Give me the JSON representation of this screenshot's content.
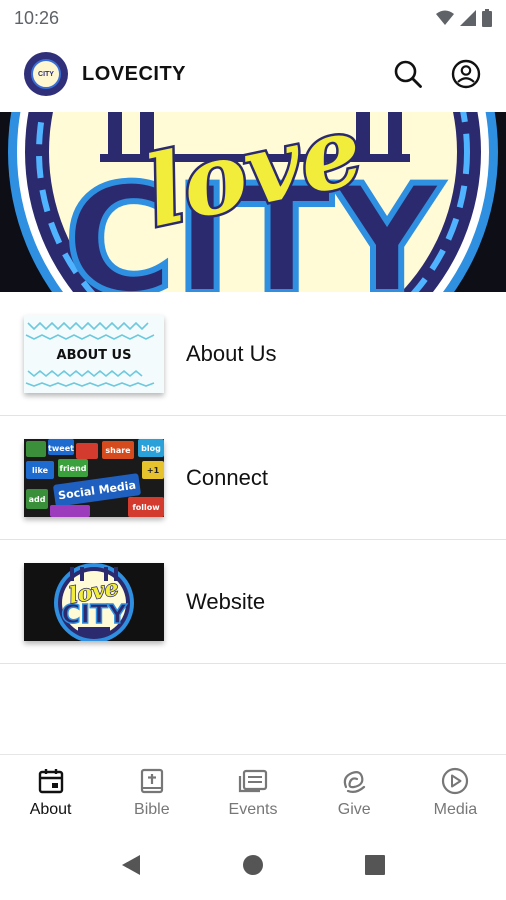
{
  "status_bar": {
    "time": "10:26"
  },
  "app_bar": {
    "title": "LOVECITY",
    "logo_text": "CITY"
  },
  "banner": {
    "script_text": "love",
    "block_text": "CITY"
  },
  "list": {
    "items": [
      {
        "label": "About Us",
        "thumb_text": "ABOUT US"
      },
      {
        "label": "Connect",
        "thumb_text": "Social Media",
        "thumb_tags": [
          "tweet",
          "friend",
          "share",
          "blog",
          "like",
          "add",
          "follow",
          "+1"
        ]
      },
      {
        "label": "Website",
        "thumb_text": "love",
        "thumb_text2": "CITY"
      }
    ]
  },
  "bottom_nav": {
    "items": [
      {
        "label": "About",
        "icon": "calendar-icon",
        "active": true
      },
      {
        "label": "Bible",
        "icon": "bible-icon",
        "active": false
      },
      {
        "label": "Events",
        "icon": "events-icon",
        "active": false
      },
      {
        "label": "Give",
        "icon": "give-icon",
        "active": false
      },
      {
        "label": "Media",
        "icon": "play-circle-icon",
        "active": false
      }
    ]
  },
  "colors": {
    "navy": "#2b2a6e",
    "yellow": "#f2ec3a",
    "cream": "#fffbd6",
    "blue": "#2f8fe0"
  }
}
